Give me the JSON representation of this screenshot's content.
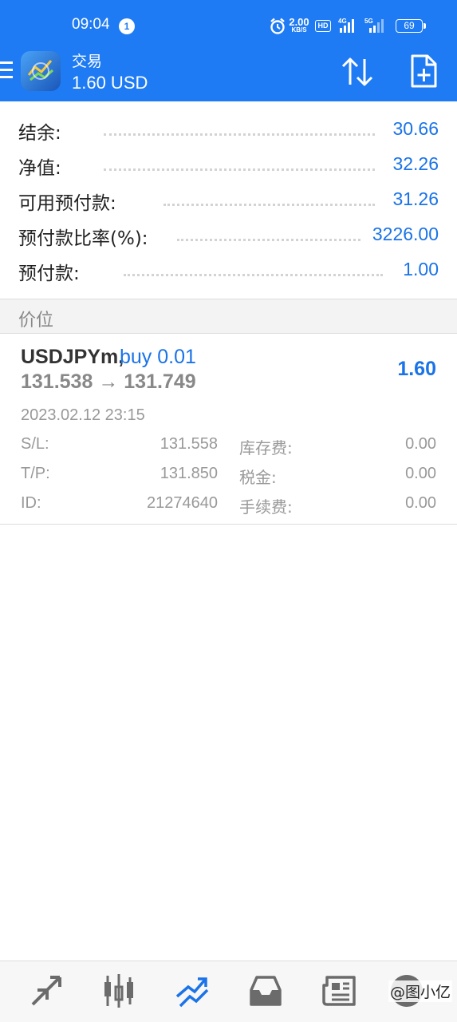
{
  "status_bar": {
    "time": "09:04",
    "notification_count": "1",
    "net_speed_value": "2.00",
    "net_speed_unit": "KB/S",
    "hd_label": "HD",
    "signal_1_label": "4G",
    "signal_2_label": "5G",
    "battery": "69"
  },
  "toolbar": {
    "title": "交易",
    "subtitle": "1.60 USD"
  },
  "summary": [
    {
      "label": "结余:",
      "value": "30.66"
    },
    {
      "label": "净值:",
      "value": "32.26"
    },
    {
      "label": "可用预付款:",
      "value": "31.26"
    },
    {
      "label": "预付款比率(%):",
      "value": "3226.00"
    },
    {
      "label": "预付款:",
      "value": "1.00"
    }
  ],
  "section": {
    "title": "价位"
  },
  "position": {
    "symbol": "USDJPYm,",
    "type": "buy 0.01",
    "prices": "131.538 → 131.749",
    "profit": "1.60",
    "time": "2023.02.12 23:15",
    "rows": [
      {
        "k1": "S/L:",
        "v1": "131.558",
        "k2": "库存费:",
        "v2": "0.00"
      },
      {
        "k1": "T/P:",
        "v1": "131.850",
        "k2": "税金:",
        "v2": "0.00"
      },
      {
        "k1": "ID:",
        "v1": "21274640",
        "k2": "手续费:",
        "v2": "0.00"
      }
    ]
  },
  "bottom_nav": {
    "items": [
      "quotes-icon",
      "chart-icon",
      "trade-icon",
      "history-icon",
      "news-icon",
      "settings-icon"
    ],
    "active_color": "#1a73e8",
    "inactive_color": "#6b6b6b"
  },
  "watermark": "@图小亿",
  "colors": {
    "header_bg": "#1e7bf4",
    "value_blue": "#1a73e8"
  }
}
